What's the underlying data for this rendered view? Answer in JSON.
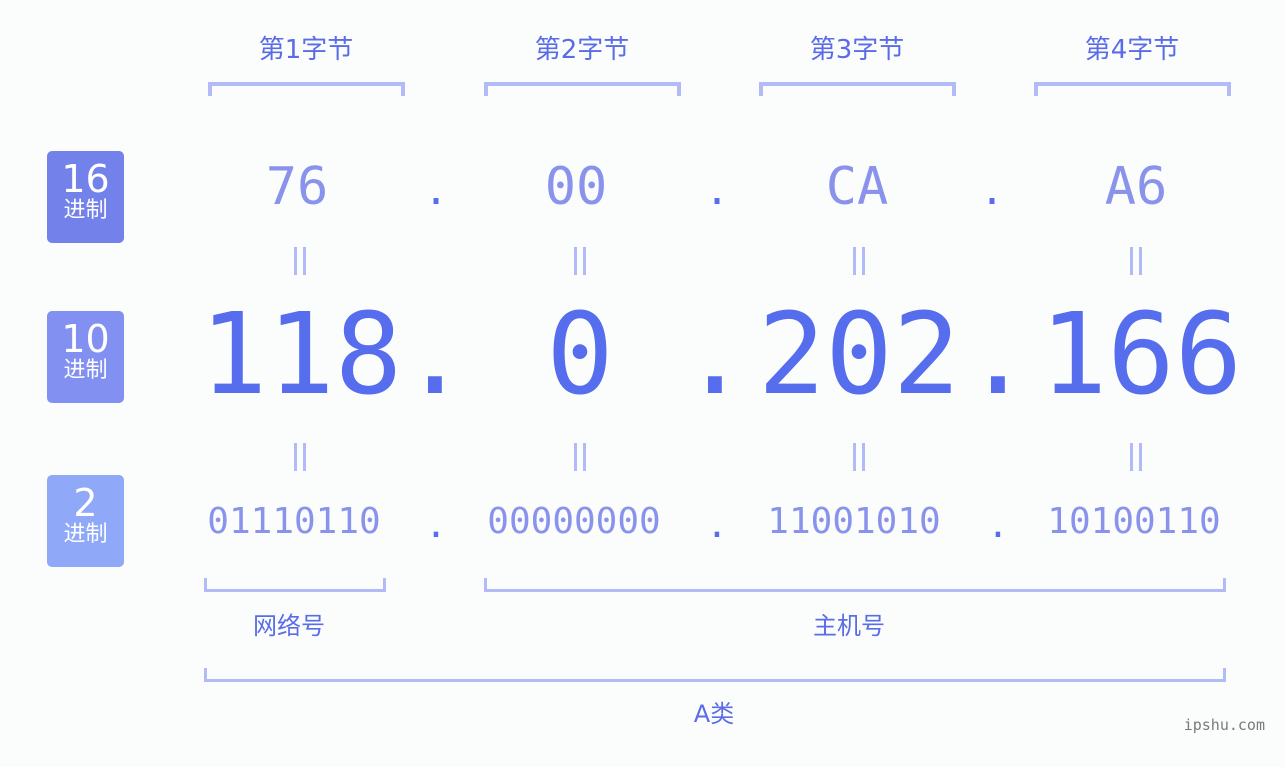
{
  "bytes": [
    {
      "label": "第1字节",
      "hex": "76",
      "dec": "118",
      "bin": "01110110"
    },
    {
      "label": "第2字节",
      "hex": "00",
      "dec": "0",
      "bin": "00000000"
    },
    {
      "label": "第3字节",
      "hex": "CA",
      "dec": "202",
      "bin": "11001010"
    },
    {
      "label": "第4字节",
      "hex": "A6",
      "dec": "166",
      "bin": "10100110"
    }
  ],
  "separator": ".",
  "badges": {
    "hex": {
      "num": "16",
      "unit": "进制",
      "color": "#7381ea"
    },
    "dec": {
      "num": "10",
      "unit": "进制",
      "color": "#8291f1"
    },
    "bin": {
      "num": "2",
      "unit": "进制",
      "color": "#8fa8f7"
    }
  },
  "groups": {
    "network": "网络号",
    "host": "主机号",
    "class": "A类"
  },
  "watermark": "ipshu.com",
  "colors": {
    "accent": "#566ded",
    "light": "#8a93ec",
    "bracket": "#b2baf8"
  }
}
